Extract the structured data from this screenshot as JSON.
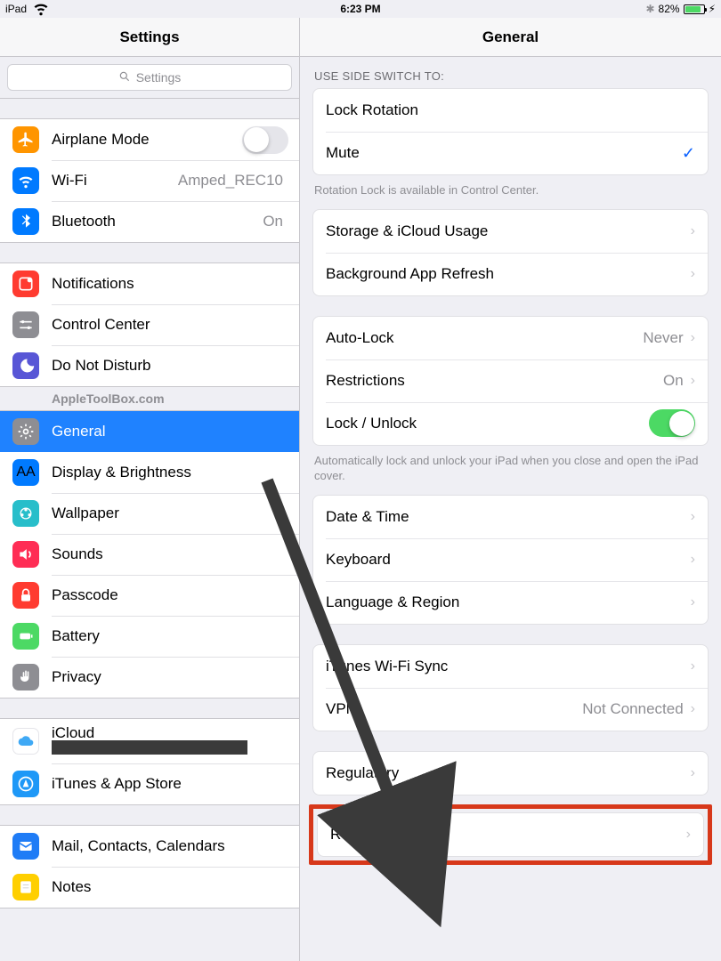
{
  "statusbar": {
    "device": "iPad",
    "time": "6:23 PM",
    "battery_pct": "82%"
  },
  "sidebar": {
    "title": "Settings",
    "search_placeholder": "Settings",
    "watermark": "AppleToolBox.com",
    "groups": {
      "connectivity": {
        "airplane": "Airplane Mode",
        "wifi": "Wi-Fi",
        "wifi_value": "Amped_REC10",
        "bluetooth": "Bluetooth",
        "bluetooth_value": "On"
      },
      "notifications": {
        "notifications": "Notifications",
        "control_center": "Control Center",
        "dnd": "Do Not Disturb"
      },
      "general": {
        "general": "General",
        "display": "Display & Brightness",
        "wallpaper": "Wallpaper",
        "sounds": "Sounds",
        "passcode": "Passcode",
        "battery": "Battery",
        "privacy": "Privacy"
      },
      "account": {
        "icloud": "iCloud",
        "itunes": "iTunes & App Store"
      },
      "apps": {
        "mail": "Mail, Contacts, Calendars",
        "notes": "Notes"
      }
    }
  },
  "detail": {
    "title": "General",
    "side_switch_header": "USE SIDE SWITCH TO:",
    "lock_rotation": "Lock Rotation",
    "mute": "Mute",
    "rotation_footer": "Rotation Lock is available in Control Center.",
    "storage": "Storage & iCloud Usage",
    "bg_refresh": "Background App Refresh",
    "autolock": "Auto-Lock",
    "autolock_value": "Never",
    "restrictions": "Restrictions",
    "restrictions_value": "On",
    "lock_unlock": "Lock / Unlock",
    "lock_unlock_footer": "Automatically lock and unlock your iPad when you close and open the iPad cover.",
    "datetime": "Date & Time",
    "keyboard": "Keyboard",
    "language": "Language & Region",
    "itunes_sync": "iTunes Wi-Fi Sync",
    "vpn": "VPN",
    "vpn_value": "Not Connected",
    "regulatory": "Regulatory",
    "reset": "Reset"
  },
  "icon_colors": {
    "airplane": "#ff9500",
    "wifi": "#007aff",
    "bluetooth": "#007aff",
    "notifications": "#ff3b30",
    "control_center": "#8e8e93",
    "dnd": "#5856d6",
    "general": "#8e8e93",
    "display": "#007aff",
    "wallpaper": "#28beca",
    "sounds": "#ff2d55",
    "passcode": "#ff3b30",
    "battery": "#4cd964",
    "privacy": "#8e8e93",
    "icloud": "#ffffff",
    "itunes": "#1e98f7",
    "mail": "#1f7cf6",
    "notes": "#ffcf00"
  }
}
